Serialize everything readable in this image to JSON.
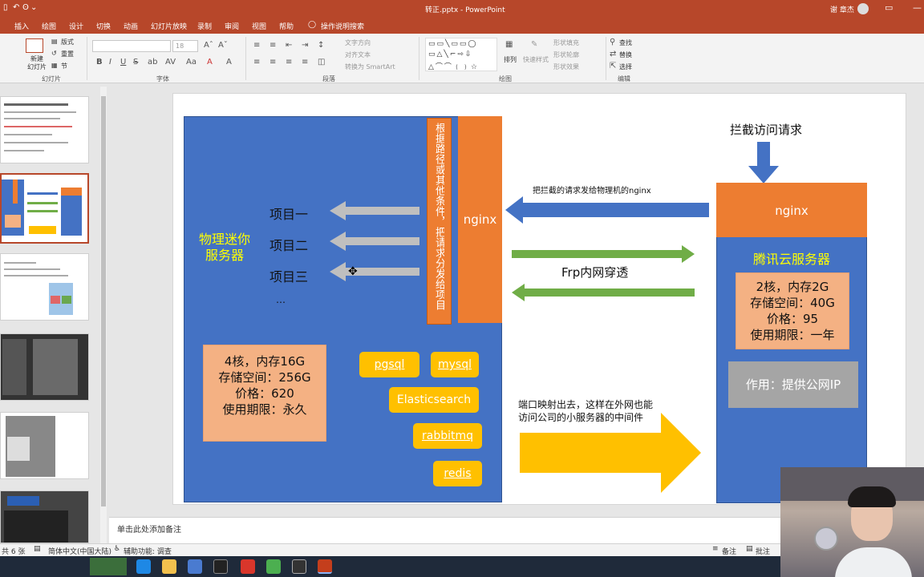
{
  "window": {
    "title": "转正.pptx - PowerPoint",
    "user": "谢 章杰",
    "quick_access": [
      "▯",
      "↶",
      "ʘ",
      "⌄"
    ],
    "controls": [
      "▭",
      "—",
      "▢",
      "✕"
    ]
  },
  "tabs": [
    "插入",
    "绘图",
    "设计",
    "切换",
    "动画",
    "幻灯片放映",
    "录制",
    "审阅",
    "视图",
    "帮助",
    "操作说明搜索"
  ],
  "ribbon": {
    "new_slide": "新建\n幻灯片",
    "layout": "版式",
    "reset": "重置",
    "section": "节",
    "slides_group": "幻灯片",
    "font_group": "字体",
    "paragraph_group": "段落",
    "drawing_group": "绘图",
    "editing_group": "编辑",
    "font_size": "18",
    "text_direction": "文字方向",
    "align_text": "对齐文本",
    "smartart": "转换为 SmartArt",
    "arrange": "排列",
    "quick_styles": "快速样式",
    "shape_fill": "形状填充",
    "shape_outline": "形状轮廓",
    "shape_effects": "形状效果",
    "find": "查找",
    "replace": "替换",
    "select": "选择"
  },
  "slide": {
    "left_box_title": "物理迷你\n服务器",
    "routing_label": "根据路径或其他条件，把请求分发给项目",
    "nginx_left": "nginx",
    "projects": [
      "项目一",
      "项目二",
      "项目三"
    ],
    "ellipsis": "…",
    "local_spec": "4核，内存16G\n存储空间：256G\n价格：620\n使用期限：永久",
    "databases": [
      "pgsql",
      "mysql",
      "Elasticsearch",
      "rabbitmq",
      "redis"
    ],
    "intercept_label": "拦截访问请求",
    "forward_label": "把拦截的请求发给物理机的nginx",
    "frp_label": "Frp内网穿透",
    "port_label": "端口映射出去，这样在外网也能\n访问公司的小服务器的中间件",
    "nginx_right": "nginx",
    "cloud_title": "腾讯云服务器",
    "cloud_spec": "2核，内存2G\n存储空间：40G\n价格：95\n使用期限：一年",
    "cloud_role": "作用：提供公网IP"
  },
  "notes_placeholder": "单击此处添加备注",
  "status": {
    "slide_count": "共 6 张",
    "language": "简体中文(中国大陆)",
    "accessibility": "辅助功能: 调查",
    "notes": "备注",
    "comments": "批注"
  },
  "colors": {
    "accent": "#b7472a",
    "blue": "#4472c4",
    "orange": "#ed7d31",
    "yellow": "#ffc000",
    "green": "#70ad47",
    "salmon": "#f4b183",
    "gray_box": "#a5a5a5",
    "label_yellow": "#ffff00"
  }
}
